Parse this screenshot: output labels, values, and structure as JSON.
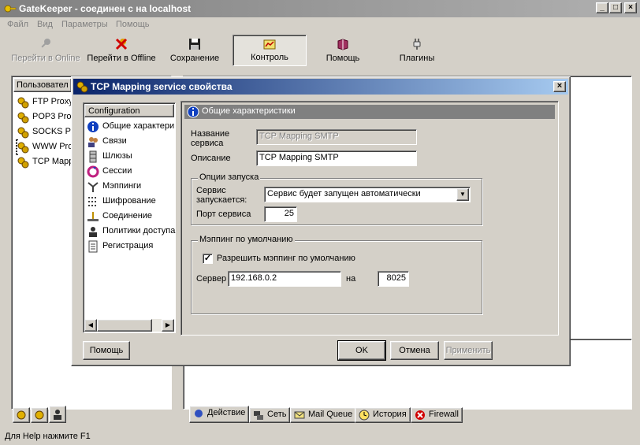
{
  "window": {
    "title": "GateKeeper - соединен с на localhost"
  },
  "menu": [
    "Файл",
    "Вид",
    "Параметры",
    "Помощь"
  ],
  "toolbar": [
    {
      "label": "Перейти в Online",
      "icon": "key-icon",
      "disabled": true
    },
    {
      "label": "Перейти в Offline",
      "icon": "key-cross-icon"
    },
    {
      "label": "Сохранение",
      "icon": "floppy-icon"
    },
    {
      "label": "Контроль",
      "icon": "monitor-chart-icon",
      "pressed": true
    },
    {
      "label": "Помощь",
      "icon": "help-book-icon"
    },
    {
      "label": "Плагины",
      "icon": "plug-icon"
    }
  ],
  "left_panel": {
    "header": "Пользовател",
    "items": [
      "FTP Proxy",
      "POP3 Prox",
      "SOCKS Pr",
      "WWW Pro",
      "TCP Mapp"
    ]
  },
  "bottom_tabs": [
    {
      "label": "Действие",
      "icon": "gear-icon"
    },
    {
      "label": "Сеть",
      "icon": "network-icon"
    },
    {
      "label": "Mail Queue",
      "icon": "mail-icon"
    },
    {
      "label": "История",
      "icon": "clock-icon"
    },
    {
      "label": "Firewall",
      "icon": "stop-icon"
    }
  ],
  "status_bar": "Для Help нажмите F1",
  "dialog": {
    "title": "TCP Mapping service свойства",
    "config_header": "Configuration",
    "config_items": [
      {
        "label": "Общие характери",
        "icon": "info-icon"
      },
      {
        "label": "Связи",
        "icon": "users-icon"
      },
      {
        "label": "Шлюзы",
        "icon": "gateway-icon"
      },
      {
        "label": "Сессии",
        "icon": "sessions-icon"
      },
      {
        "label": "Мэппинги",
        "icon": "mapping-icon"
      },
      {
        "label": "Шифрование",
        "icon": "encryption-icon"
      },
      {
        "label": "Соединение",
        "icon": "connection-icon"
      },
      {
        "label": "Политики доступа",
        "icon": "policy-icon"
      },
      {
        "label": "Регистрация",
        "icon": "document-icon"
      }
    ],
    "panel_title": "Общие характеристики",
    "service_name_label": "Название сервиса",
    "service_name_value": "TCP Mapping SMTP",
    "description_label": "Описание",
    "description_value": "TCP Mapping SMTP",
    "start_options": {
      "title": "Опции запуска",
      "starts_label": "Сервис запускается:",
      "starts_value": "Сервис будет запущен автоматически",
      "port_label": "Порт сервиса",
      "port_value": "25"
    },
    "default_mapping": {
      "title": "Мэппинг по умолчанию",
      "allow_label": "Разрешить мэппинг по умолчанию",
      "allow_checked": true,
      "server_label": "Сервер",
      "server_value": "192.168.0.2",
      "on_label": "на",
      "port_value": "8025"
    },
    "buttons": {
      "help": "Помощь",
      "ok": "OK",
      "cancel": "Отмена",
      "apply": "Применить"
    }
  }
}
